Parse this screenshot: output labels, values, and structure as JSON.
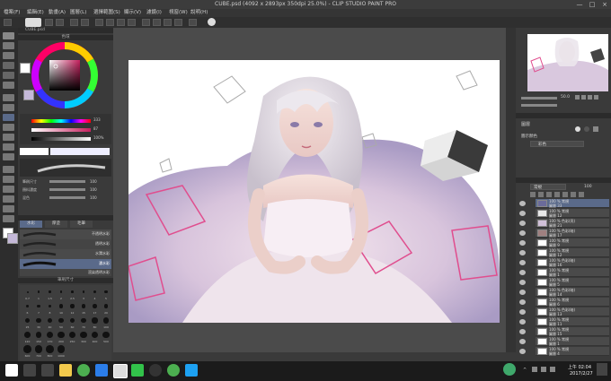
{
  "window": {
    "title": "CUBE.psd (4092 x 2893px 350dpi 25.0%) - CLIP STUDIO PAINT PRO",
    "minimize": "—",
    "maximize": "□",
    "close": "×"
  },
  "menu": [
    "檔案(F)",
    "編輯(E)",
    "動畫(A)",
    "圖層(L)",
    "選擇範圍(S)",
    "顯示(V)",
    "濾鏡(I)",
    "視窗(W)",
    "說明(H)"
  ],
  "left": {
    "tab_label": "CUBE.psd",
    "color_wheel_title": "色環",
    "sliders": [
      {
        "label": "",
        "value": "333"
      },
      {
        "label": "",
        "value": "87"
      },
      {
        "label": "",
        "value": "100%"
      }
    ],
    "brush_size_value": "100",
    "brush_opacity_value": "100",
    "brush_props": [
      {
        "label": "筆刷尺寸",
        "value": "100"
      },
      {
        "label": "顏料濃度",
        "value": "100"
      },
      {
        "label": "混色",
        "value": "100"
      }
    ],
    "brush_tabs": [
      "水彩",
      "厚塗",
      "毛筆"
    ],
    "brush_list": [
      "不透明水彩",
      "透明水彩",
      "水潤水彩",
      "濃水彩",
      "渲染透明水彩"
    ],
    "brush_size_header": "筆刷尺寸",
    "brush_sizes": [
      "0.7",
      "1",
      "1.5",
      "2",
      "2.5",
      "3",
      "4",
      "5",
      "6",
      "7",
      "8",
      "10",
      "12",
      "15",
      "17",
      "20",
      "25",
      "30",
      "40",
      "50",
      "60",
      "70",
      "80",
      "100",
      "120",
      "150",
      "170",
      "200",
      "250",
      "300",
      "400",
      "500",
      "600",
      "700",
      "800",
      "1000"
    ]
  },
  "right": {
    "nav_zoom": "50.0",
    "tool_property_title": "圖層",
    "color_mode_label": "圖示顏色",
    "color_mode_value": "彩色",
    "layer_blend": "常規",
    "layer_opacity": "100",
    "layers": [
      {
        "name": "100 % 常規",
        "sub": "圖層 33",
        "color": "#6b6b9a"
      },
      {
        "name": "100 % 常規",
        "sub": "圖層 12",
        "color": "#e8e8e8"
      },
      {
        "name": "100 % 色彩(亮)",
        "sub": "圖層 21",
        "color": "#d0c0d8"
      },
      {
        "name": "100 % 色彩(暗)",
        "sub": "圖層 17",
        "color": "#a08080"
      },
      {
        "name": "100 % 常規",
        "sub": "圖層 9",
        "color": "#ffffff"
      },
      {
        "name": "100 % 常規",
        "sub": "圖層 12",
        "color": "#ffffff"
      },
      {
        "name": "100 % 色彩(暗)",
        "sub": "圖層 16",
        "color": "#ffffff"
      },
      {
        "name": "100 % 常規",
        "sub": "圖層 1",
        "color": "#ffffff"
      },
      {
        "name": "100 % 常規",
        "sub": "圖層 5",
        "color": "#ffffff"
      },
      {
        "name": "100 % 色彩(暗)",
        "sub": "圖層 14",
        "color": "#ffffff"
      },
      {
        "name": "100 % 常規",
        "sub": "圖層 6",
        "color": "#ffffff"
      },
      {
        "name": "100 % 色彩(暗)",
        "sub": "圖層 13",
        "color": "#ffffff"
      },
      {
        "name": "100 % 常規",
        "sub": "圖層 11",
        "color": "#ffffff"
      },
      {
        "name": "100 % 常規",
        "sub": "圖層 15",
        "color": "#ffffff"
      },
      {
        "name": "100 % 常規",
        "sub": "圖層 1",
        "color": "#ffffff"
      },
      {
        "name": "100 % 常規",
        "sub": "圖層 4",
        "color": "#ffffff"
      }
    ]
  },
  "taskbar": {
    "time": "上午 02:04",
    "date": "2017/2/27",
    "apps": [
      "start-icon",
      "search-icon",
      "task-view-icon",
      "explorer-icon",
      "chrome-icon",
      "edge-icon",
      "clip-studio-icon",
      "line-icon",
      "photos-icon",
      "media-icon",
      "game-icon",
      "twitter-icon"
    ]
  }
}
